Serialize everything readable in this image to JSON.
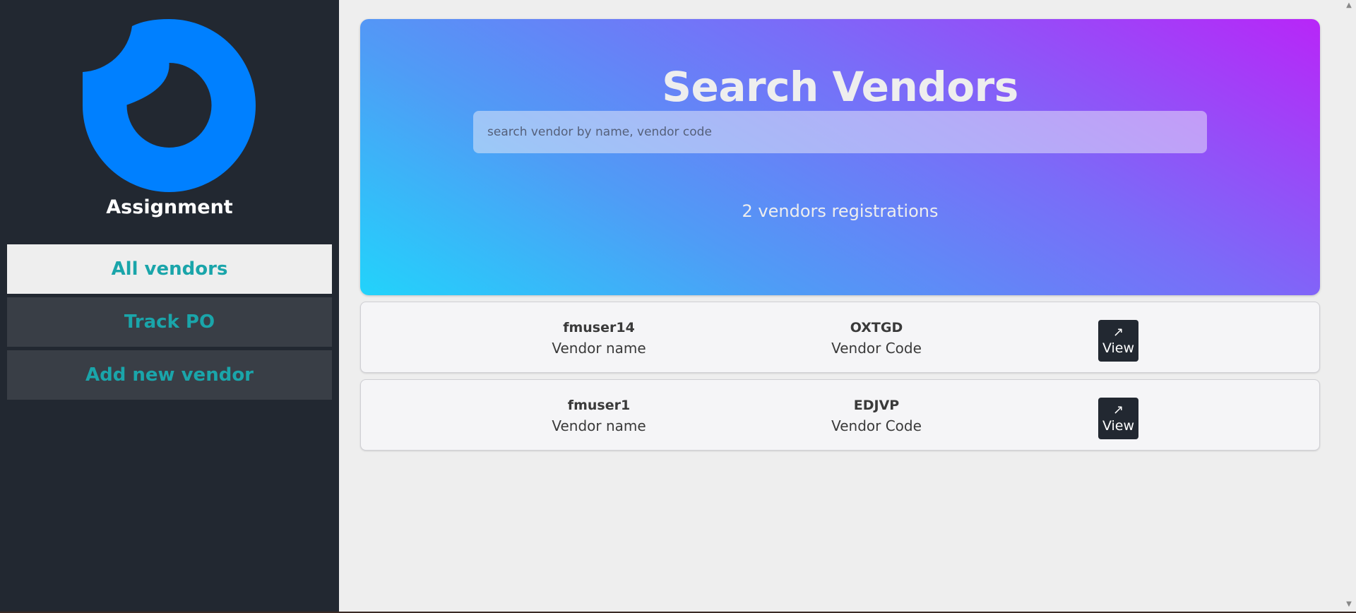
{
  "sidebar": {
    "app_title": "Assignment",
    "logo_icon": "logo-icon",
    "logo_color": "#0080ff",
    "nav": [
      {
        "label": "All vendors",
        "active": true
      },
      {
        "label": "Track PO",
        "active": false
      },
      {
        "label": "Add new vendor",
        "active": false
      }
    ]
  },
  "header": {
    "title": "Search Vendors",
    "search_placeholder": "search vendor by name, vendor code",
    "search_value": "",
    "count_text": "2 vendors registrations"
  },
  "vendors": [
    {
      "name": "fmuser14",
      "name_label": "Vendor name",
      "code": "OXTGD",
      "code_label": "Vendor Code",
      "view_icon": "↗",
      "view_label": "View"
    },
    {
      "name": "fmuser1",
      "name_label": "Vendor name",
      "code": "EDJVP",
      "code_label": "Vendor Code",
      "view_icon": "↗",
      "view_label": "View"
    }
  ],
  "colors": {
    "sidebar_bg": "#222831",
    "nav_bg": "#393e46",
    "nav_text": "#1aa5aa",
    "gradient_start": "#22d3fb",
    "gradient_end": "#b826f8"
  }
}
